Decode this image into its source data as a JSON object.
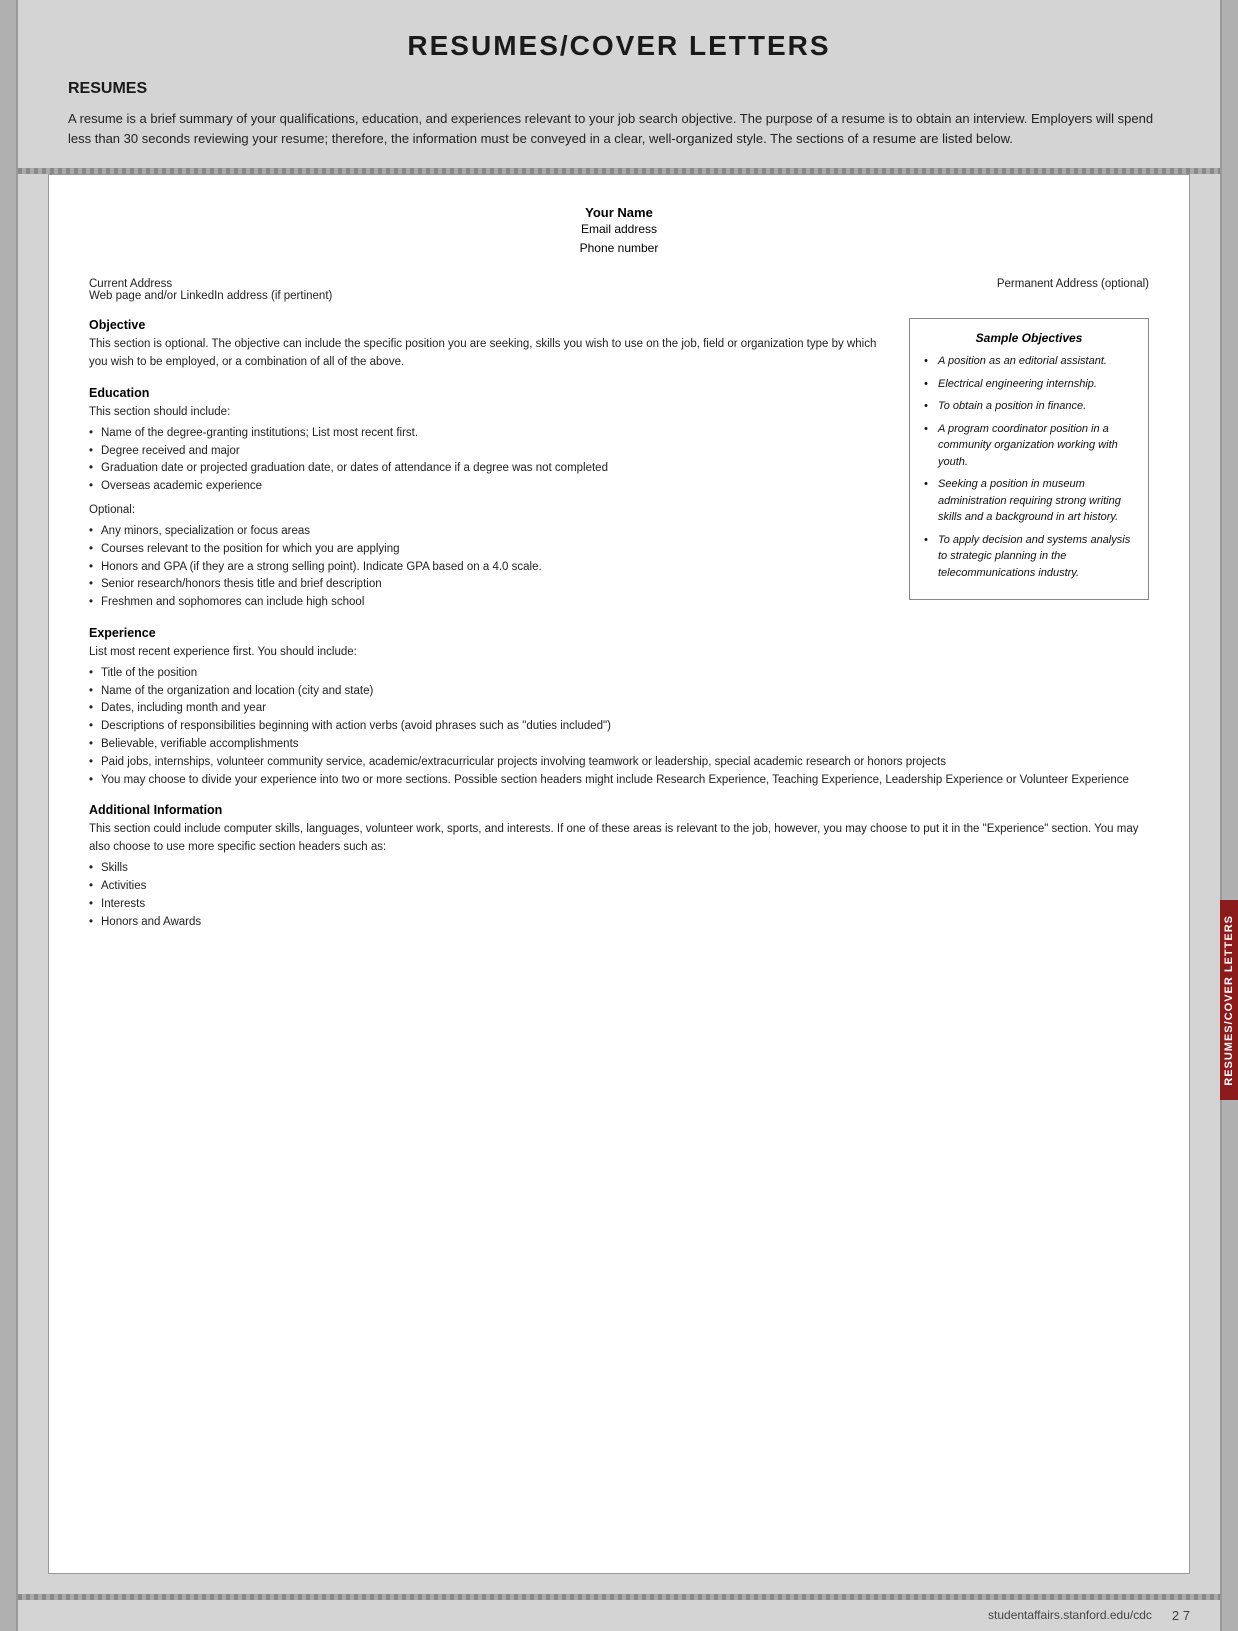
{
  "page": {
    "title": "RESUMES/COVER LETTERS",
    "footer_url": "studentaffairs.stanford.edu/cdc",
    "footer_page": "2 7"
  },
  "right_tab": {
    "text": "RESUMES/COVER LETTERS"
  },
  "intro": {
    "heading": "RESUMES",
    "body": "A resume is a brief summary of your qualifications, education, and experiences relevant to your job search objective. The purpose of a resume is to obtain an interview. Employers will spend less than 30 seconds reviewing your resume; therefore, the information must be conveyed in a clear, well-organized style. The sections of a resume are listed below."
  },
  "resume_template": {
    "name": "Your Name",
    "email": "Email address",
    "phone": "Phone number",
    "current_address_label": "Current Address",
    "current_address_sub": "Web page and/or LinkedIn address (if pertinent)",
    "permanent_address_label": "Permanent Address (optional)",
    "sections": [
      {
        "title": "Objective",
        "body": "This section is optional. The objective can include the specific position you are seeking, skills you wish to use on the job, field or organization type by which you wish to be employed, or a combination of all of the above."
      },
      {
        "title": "Education",
        "body": "This section should include:",
        "bullets": [
          "Name of the degree-granting institutions; List most recent first.",
          "Degree received and major",
          "Graduation date or projected graduation date, or dates of attendance if a degree was not completed",
          "Overseas academic experience"
        ],
        "optional_label": "Optional:",
        "optional_bullets": [
          "Any minors, specialization or focus areas",
          "Courses relevant to the position for which you are applying",
          "Honors and GPA (if they are a strong selling point). Indicate GPA based on a 4.0 scale.",
          "Senior research/honors thesis title and brief description",
          "Freshmen and sophomores can include high school"
        ]
      },
      {
        "title": "Experience",
        "body": "List most recent experience first. You should include:",
        "bullets": [
          "Title of the position",
          "Name of the organization and location (city and state)",
          "Dates, including month and year",
          "Descriptions of responsibilities beginning with action verbs (avoid phrases such as \"duties included\")",
          "Believable, verifiable accomplishments",
          "Paid jobs, internships, volunteer community service, academic/extracurricular projects involving teamwork or leadership, special academic research or honors projects",
          "You may choose to divide your experience into two or more sections. Possible section headers might include Research Experience, Teaching Experience, Leadership Experience or Volunteer Experience"
        ]
      },
      {
        "title": "Additional Information",
        "body": "This section could include computer skills, languages, volunteer work, sports, and interests. If one of these areas is relevant to the job, however, you may choose to put it in the \"Experience\" section. You may also choose to use more specific section headers such as:",
        "bullets": [
          "Skills",
          "Activities",
          "Interests",
          "Honors and Awards"
        ]
      }
    ]
  },
  "sample_objectives": {
    "title": "Sample Objectives",
    "items": [
      "A position as an editorial assistant.",
      "Electrical engineering internship.",
      "To obtain a position in finance.",
      "A program coordinator position in a community organization working with youth.",
      "Seeking a position in museum administration requiring strong writing skills and a background in art history.",
      "To apply decision and systems analysis to strategic planning in the telecommunications industry."
    ]
  }
}
